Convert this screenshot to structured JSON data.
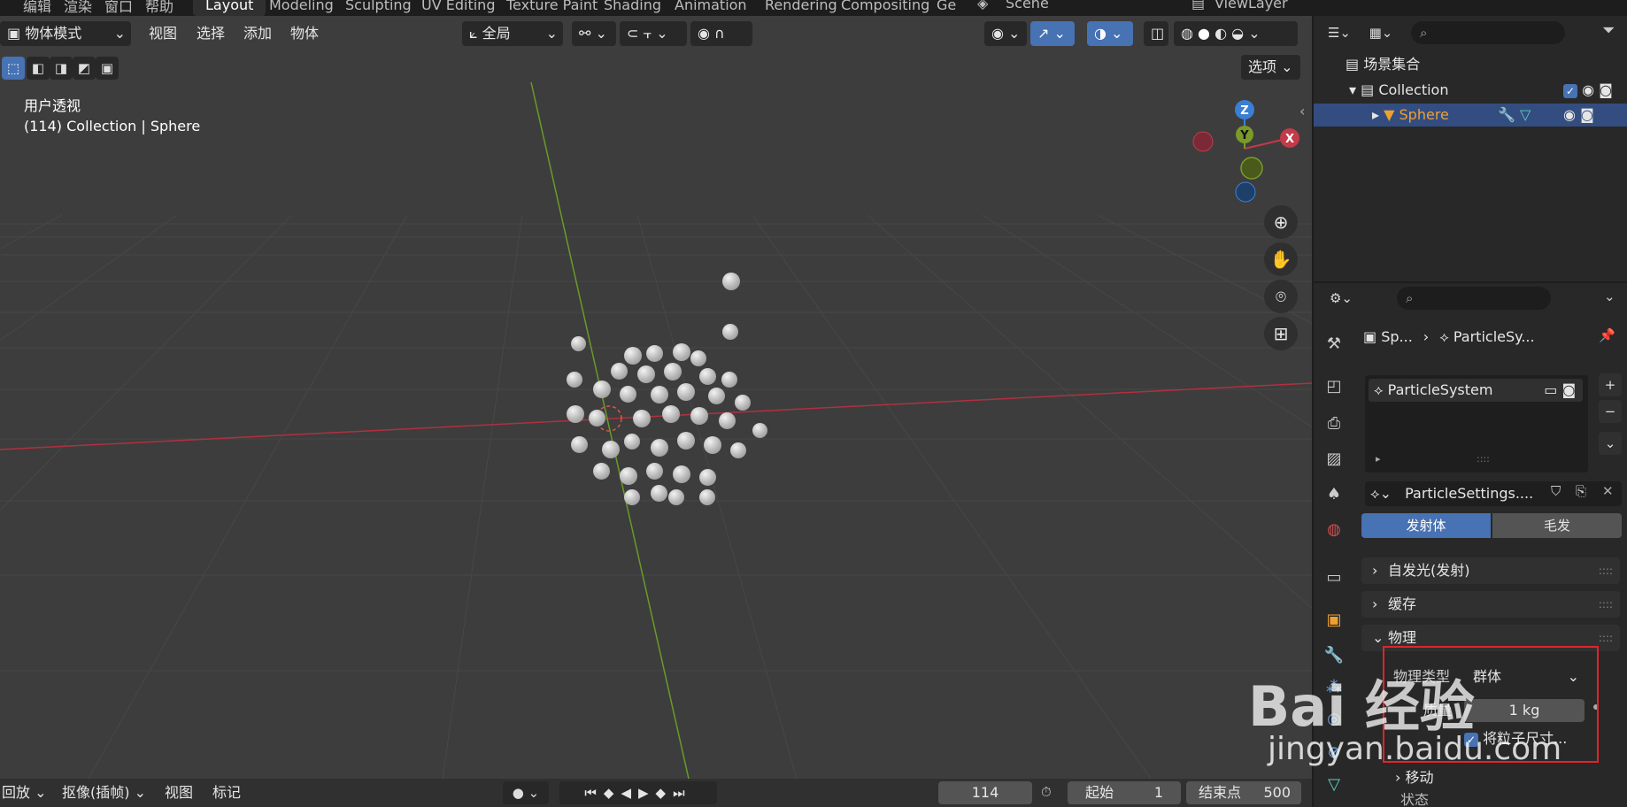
{
  "topbar": {
    "menus": [
      "编辑",
      "渲染",
      "窗口",
      "帮助"
    ],
    "tabs": [
      "Layout",
      "Modeling",
      "Sculpting",
      "UV Editing",
      "Texture Paint",
      "Shading",
      "Animation",
      "Rendering",
      "Compositing",
      "Ge"
    ],
    "active_tab": "Layout",
    "scene": "Scene",
    "view_layer": "ViewLayer"
  },
  "viewport": {
    "mode": "物体模式",
    "menus": [
      "视图",
      "选择",
      "添加",
      "物体"
    ],
    "orientation": "全局",
    "options": "选项",
    "view_name": "用户透视",
    "object_info": "(114) Collection | Sphere",
    "gizmo": {
      "z": "Z",
      "y": "Y",
      "x": "X"
    }
  },
  "outliner": {
    "scene_collection": "场景集合",
    "collection": "Collection",
    "object": "Sphere"
  },
  "properties": {
    "breadcrumb_object": "Sp...",
    "breadcrumb_system": "ParticleSy...",
    "particle_system": "ParticleSystem",
    "settings_name": "ParticleSettings....",
    "type_emitter": "发射体",
    "type_hair": "毛发",
    "panels": [
      "自发光(发射)",
      "缓存",
      "物理"
    ],
    "physics_type_label": "物理类型",
    "physics_type_value": "群体",
    "mass_label": "质量",
    "mass_value": "1 kg",
    "scale_mass_label": "将粒子尺寸...",
    "sub_panel": "移动",
    "next_label": "状态"
  },
  "timeline": {
    "playback": "回放",
    "keying": "抠像(插帧)",
    "view": "视图",
    "marker": "标记",
    "current_frame": "114",
    "start_label": "起始",
    "start_value": "1",
    "end_label": "结束点",
    "end_value": "500"
  },
  "watermark": {
    "logo": "Bai 经验",
    "url": "jingyan.baidu.com"
  },
  "colors": {
    "accent": "#4772b3",
    "x_axis": "#c33a48",
    "y_axis": "#7a9a2a",
    "z_axis": "#3a7fd5",
    "highlight_box": "#e0242a",
    "active_object": "#f0a030"
  }
}
